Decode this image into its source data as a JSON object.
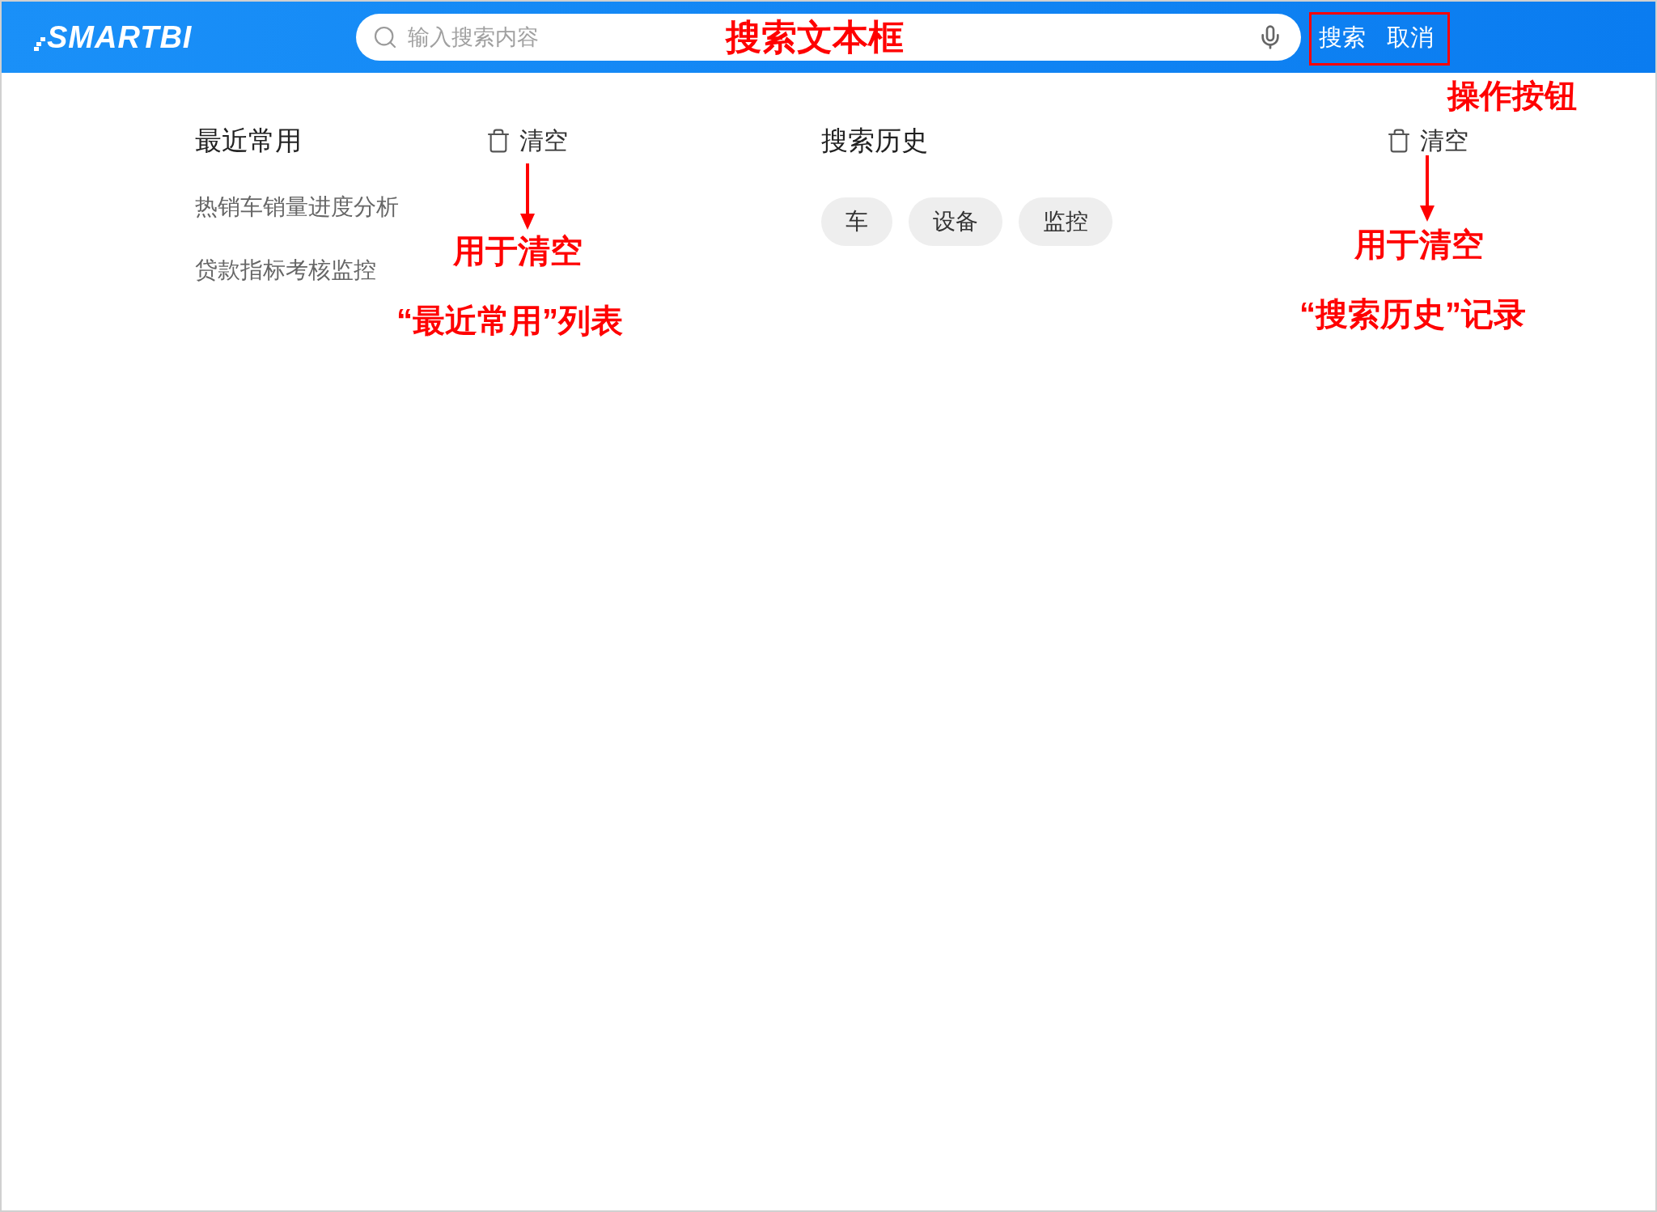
{
  "header": {
    "logo": "SMARTBI",
    "search": {
      "placeholder": "输入搜索内容"
    },
    "buttons": [
      "搜索",
      "取消"
    ]
  },
  "recent": {
    "title": "最近常用",
    "clear": "清空",
    "items": [
      "热销车销量进度分析",
      "贷款指标考核监控"
    ]
  },
  "history": {
    "title": "搜索历史",
    "clear": "清空",
    "tags": [
      "车",
      "设备",
      "监控"
    ]
  },
  "annotations": {
    "search_field": "搜索文本框",
    "action_buttons": "操作按钮",
    "recent_clear": [
      "用于清空",
      "“最近常用”列表"
    ],
    "history_clear": [
      "用于清空",
      "“搜索历史”记录"
    ]
  }
}
